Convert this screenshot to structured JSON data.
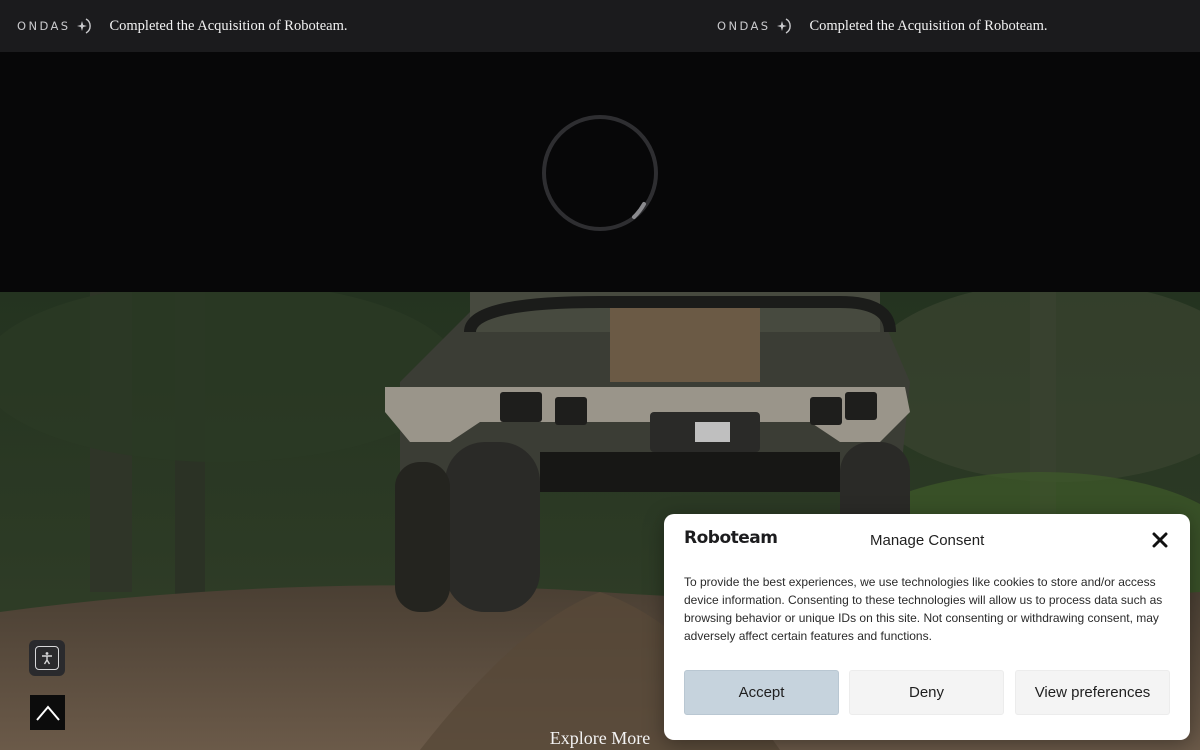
{
  "ticker": {
    "items": [
      {
        "logo": "ONDAS",
        "text": "Completed the Acquisition of Roboteam."
      },
      {
        "logo": "ONDAS",
        "text": "Completed the Acquisition of Roboteam."
      }
    ]
  },
  "loader": {
    "icon": "loading-spinner-icon"
  },
  "hero": {
    "explore_label": "Explore More",
    "image": "rugged-unmanned-ground-vehicle-in-mud"
  },
  "floating": {
    "accessibility_icon": "accessibility-icon",
    "scroll_top_icon": "chevron-up-icon"
  },
  "consent": {
    "brand": "Roboteam",
    "title": "Manage Consent",
    "body": "To provide the best experiences, we use technologies like cookies to store and/or access device information. Consenting to these technologies will allow us to process data such as browsing behavior or unique IDs on this site. Not consenting or withdrawing consent, may adversely affect certain features and functions.",
    "accept_label": "Accept",
    "deny_label": "Deny",
    "preferences_label": "View preferences",
    "close_icon": "close-icon"
  },
  "colors": {
    "ticker_bg": "#1b1b1d",
    "page_bg": "#070708",
    "accept_bg": "#c6d3dd",
    "secondary_btn_bg": "#f4f4f4"
  }
}
